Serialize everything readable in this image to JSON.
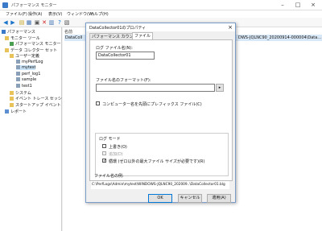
{
  "window": {
    "title": "パフォーマンス モニター"
  },
  "menu": [
    "ファイル(F)",
    "操作(A)",
    "表示(V)",
    "ウィンドウ(W)",
    "ヘルプ(H)"
  ],
  "tree": [
    {
      "label": "パフォーマンス",
      "icon": "performance-icon"
    },
    {
      "label": "モニター ツール",
      "icon": "folder-icon"
    },
    {
      "label": "パフォーマンス モニター",
      "icon": "chart-icon"
    },
    {
      "label": "データ コレクター セット",
      "icon": "folder-icon"
    },
    {
      "label": "ユーザー定義",
      "icon": "folder-icon"
    },
    {
      "label": "myPerfLog",
      "icon": "collector-set-icon"
    },
    {
      "label": "mytest",
      "icon": "collector-set-icon"
    },
    {
      "label": "perf_log1",
      "icon": "collector-set-icon"
    },
    {
      "label": "sample",
      "icon": "collector-set-icon"
    },
    {
      "label": "test1",
      "icon": "collector-set-icon"
    },
    {
      "label": "システム",
      "icon": "folder-icon"
    },
    {
      "label": "イベント トレース セッション",
      "icon": "folder-icon"
    },
    {
      "label": "スタートアップ イベント トレー",
      "icon": "folder-icon"
    },
    {
      "label": "レポート",
      "icon": "report-icon"
    }
  ],
  "right": {
    "column_header": "名前",
    "row_name": "DataColl",
    "row_right": "DWS-JQLNC90_20200914-000004\\Data..."
  },
  "dialog": {
    "title": "DataCollector01のプロパティ",
    "tabs": [
      "パフォーマンス カウンター",
      "ファイル"
    ],
    "log_file_name_label": "ログ ファイル名(N):",
    "log_file_name_value": "DataCollector01",
    "file_name_format_label": "ファイル名のフォーマット(F):",
    "file_name_format_value": "",
    "prefix_label": "コンピューター名を先頭にプレフィックス ファイル(C)",
    "log_mode_label": "ログ モード",
    "overwrite_label": "上書き(O)",
    "append_label": "追加(D)",
    "circular_label": "循環 (ゼロ以外の最大ファイル サイズが必要です)(R)",
    "file_path_label": "ファイル名の例:",
    "file_path_value": "C:\\PerfLogs\\Admin\\mytest\\WINDOWS-JQLNC90_202009..\\DataCollector01.blg",
    "ok": "OK",
    "cancel": "キャンセル",
    "apply": "適用(A)"
  }
}
